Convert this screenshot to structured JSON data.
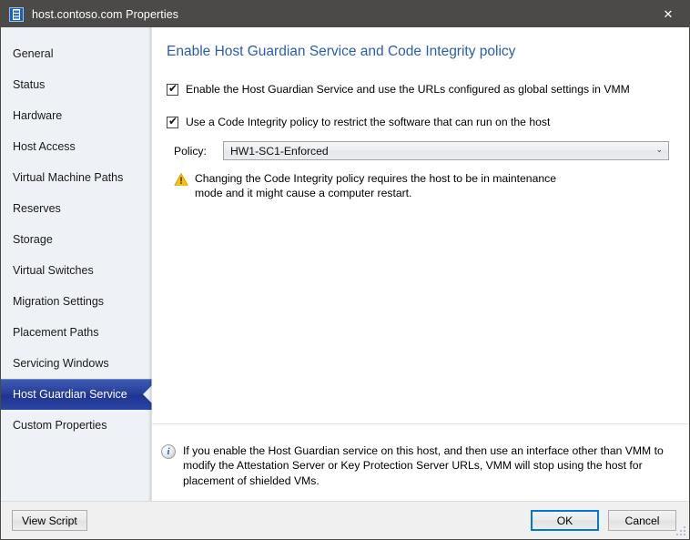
{
  "window": {
    "title": "host.contoso.com Properties",
    "icon": "server-icon",
    "close_label": "✕"
  },
  "sidebar": {
    "items": [
      {
        "label": "General",
        "selected": false
      },
      {
        "label": "Status",
        "selected": false
      },
      {
        "label": "Hardware",
        "selected": false
      },
      {
        "label": "Host Access",
        "selected": false
      },
      {
        "label": "Virtual Machine Paths",
        "selected": false
      },
      {
        "label": "Reserves",
        "selected": false
      },
      {
        "label": "Storage",
        "selected": false
      },
      {
        "label": "Virtual Switches",
        "selected": false
      },
      {
        "label": "Migration Settings",
        "selected": false
      },
      {
        "label": "Placement Paths",
        "selected": false
      },
      {
        "label": "Servicing Windows",
        "selected": false
      },
      {
        "label": "Host Guardian Service",
        "selected": true
      },
      {
        "label": "Custom Properties",
        "selected": false
      }
    ]
  },
  "content": {
    "heading": "Enable Host Guardian Service and Code Integrity policy",
    "checkbox_hgs": {
      "label": "Enable the Host Guardian Service and use the URLs configured as global settings in VMM",
      "checked": true,
      "mark": "✔"
    },
    "checkbox_ci": {
      "label": "Use a Code Integrity policy to restrict the software that can run on the host",
      "checked": true,
      "mark": "✔"
    },
    "policy": {
      "label": "Policy:",
      "value": "HW1-SC1-Enforced",
      "arrow": "⌄"
    },
    "warning": {
      "icon": "warning-triangle-icon",
      "text": "Changing the Code Integrity policy requires the host to be in maintenance mode and it might cause a computer restart."
    },
    "info": {
      "icon": "info-circle-icon",
      "glyph": "i",
      "text": "If you enable the Host Guardian service on this host, and then use an interface other than VMM to modify the Attestation Server or Key Protection Server URLs, VMM will stop using the host for placement of shielded VMs."
    }
  },
  "footer": {
    "view_script_label": "View Script",
    "ok_label": "OK",
    "cancel_label": "Cancel"
  },
  "colors": {
    "titlebar": "#4c4a48",
    "heading": "#2a5db0",
    "selection_blue": "#27409a",
    "sidebar_bg": "#eef1f5",
    "accent_focus": "#0078d7",
    "warning_yellow": "#ffc000"
  }
}
